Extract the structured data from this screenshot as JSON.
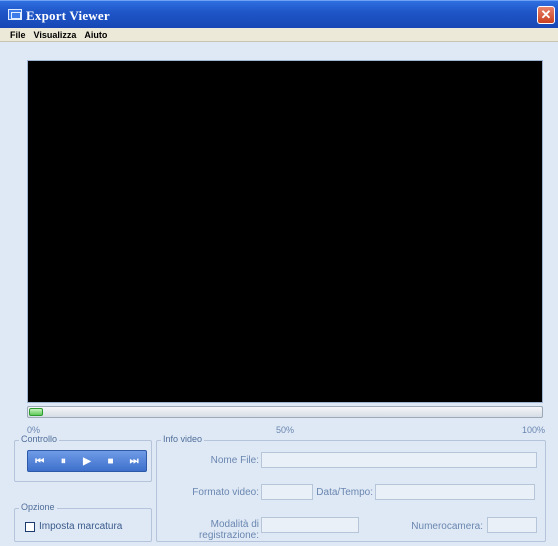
{
  "window": {
    "title": "Export Viewer",
    "close_glyph": "✕"
  },
  "menu": {
    "items": [
      "File",
      "Visualizza",
      "Aiuto"
    ]
  },
  "progress": {
    "value": 0.0,
    "scale": [
      "0%",
      "50%",
      "100%"
    ]
  },
  "controls": {
    "group_label": "Controllo",
    "buttons": [
      {
        "icon": "skip-back-icon",
        "glyph": "⏮"
      },
      {
        "icon": "pause-icon",
        "glyph": "⏸"
      },
      {
        "icon": "play-icon",
        "glyph": "▶"
      },
      {
        "icon": "stop-icon",
        "glyph": "■"
      },
      {
        "icon": "skip-forward-icon",
        "glyph": "⏭"
      }
    ]
  },
  "options": {
    "group_label": "Opzione",
    "checkbox_label": "Imposta marcatura",
    "checked": false
  },
  "info": {
    "group_label": "Info video",
    "file_name_label": "Nome File:",
    "file_name_value": "",
    "format_label": "Formato video:",
    "format_value": "",
    "datetime_label": "Data/Tempo:",
    "datetime_value": "",
    "rec_mode_label_line1": "Modalità di",
    "rec_mode_label_line2": "registrazione:",
    "rec_mode_value": "",
    "camera_label": "Numerocamera:",
    "camera_value": ""
  }
}
